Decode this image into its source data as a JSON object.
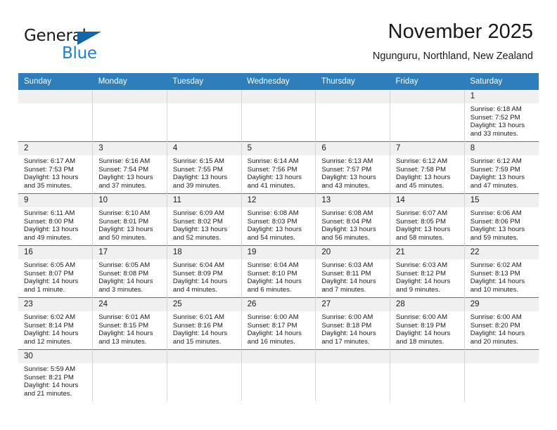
{
  "brand": {
    "name_top": "General",
    "name_bottom": "Blue",
    "flag_icon": "flag-triangle-icon",
    "color_dark": "#1a1a1a",
    "color_blue": "#1f7fd0"
  },
  "header": {
    "title": "November 2025",
    "subtitle": "Ngunguru, Northland, New Zealand"
  },
  "theme": {
    "header_bg": "#2e7ebc",
    "daynum_bg": "#f0f0f0",
    "row_border": "#2e7ebc",
    "cell_border": "#d4d4d4"
  },
  "weekday_headers": [
    "Sunday",
    "Monday",
    "Tuesday",
    "Wednesday",
    "Thursday",
    "Friday",
    "Saturday"
  ],
  "weeks": [
    [
      {
        "day": "",
        "empty": true,
        "sunrise": "",
        "sunset": "",
        "daylight1": "",
        "daylight2": ""
      },
      {
        "day": "",
        "empty": true,
        "sunrise": "",
        "sunset": "",
        "daylight1": "",
        "daylight2": ""
      },
      {
        "day": "",
        "empty": true,
        "sunrise": "",
        "sunset": "",
        "daylight1": "",
        "daylight2": ""
      },
      {
        "day": "",
        "empty": true,
        "sunrise": "",
        "sunset": "",
        "daylight1": "",
        "daylight2": ""
      },
      {
        "day": "",
        "empty": true,
        "sunrise": "",
        "sunset": "",
        "daylight1": "",
        "daylight2": ""
      },
      {
        "day": "",
        "empty": true,
        "sunrise": "",
        "sunset": "",
        "daylight1": "",
        "daylight2": ""
      },
      {
        "day": "1",
        "empty": false,
        "sunrise": "Sunrise: 6:18 AM",
        "sunset": "Sunset: 7:52 PM",
        "daylight1": "Daylight: 13 hours",
        "daylight2": "and 33 minutes."
      }
    ],
    [
      {
        "day": "2",
        "empty": false,
        "sunrise": "Sunrise: 6:17 AM",
        "sunset": "Sunset: 7:53 PM",
        "daylight1": "Daylight: 13 hours",
        "daylight2": "and 35 minutes."
      },
      {
        "day": "3",
        "empty": false,
        "sunrise": "Sunrise: 6:16 AM",
        "sunset": "Sunset: 7:54 PM",
        "daylight1": "Daylight: 13 hours",
        "daylight2": "and 37 minutes."
      },
      {
        "day": "4",
        "empty": false,
        "sunrise": "Sunrise: 6:15 AM",
        "sunset": "Sunset: 7:55 PM",
        "daylight1": "Daylight: 13 hours",
        "daylight2": "and 39 minutes."
      },
      {
        "day": "5",
        "empty": false,
        "sunrise": "Sunrise: 6:14 AM",
        "sunset": "Sunset: 7:56 PM",
        "daylight1": "Daylight: 13 hours",
        "daylight2": "and 41 minutes."
      },
      {
        "day": "6",
        "empty": false,
        "sunrise": "Sunrise: 6:13 AM",
        "sunset": "Sunset: 7:57 PM",
        "daylight1": "Daylight: 13 hours",
        "daylight2": "and 43 minutes."
      },
      {
        "day": "7",
        "empty": false,
        "sunrise": "Sunrise: 6:12 AM",
        "sunset": "Sunset: 7:58 PM",
        "daylight1": "Daylight: 13 hours",
        "daylight2": "and 45 minutes."
      },
      {
        "day": "8",
        "empty": false,
        "sunrise": "Sunrise: 6:12 AM",
        "sunset": "Sunset: 7:59 PM",
        "daylight1": "Daylight: 13 hours",
        "daylight2": "and 47 minutes."
      }
    ],
    [
      {
        "day": "9",
        "empty": false,
        "sunrise": "Sunrise: 6:11 AM",
        "sunset": "Sunset: 8:00 PM",
        "daylight1": "Daylight: 13 hours",
        "daylight2": "and 49 minutes."
      },
      {
        "day": "10",
        "empty": false,
        "sunrise": "Sunrise: 6:10 AM",
        "sunset": "Sunset: 8:01 PM",
        "daylight1": "Daylight: 13 hours",
        "daylight2": "and 50 minutes."
      },
      {
        "day": "11",
        "empty": false,
        "sunrise": "Sunrise: 6:09 AM",
        "sunset": "Sunset: 8:02 PM",
        "daylight1": "Daylight: 13 hours",
        "daylight2": "and 52 minutes."
      },
      {
        "day": "12",
        "empty": false,
        "sunrise": "Sunrise: 6:08 AM",
        "sunset": "Sunset: 8:03 PM",
        "daylight1": "Daylight: 13 hours",
        "daylight2": "and 54 minutes."
      },
      {
        "day": "13",
        "empty": false,
        "sunrise": "Sunrise: 6:08 AM",
        "sunset": "Sunset: 8:04 PM",
        "daylight1": "Daylight: 13 hours",
        "daylight2": "and 56 minutes."
      },
      {
        "day": "14",
        "empty": false,
        "sunrise": "Sunrise: 6:07 AM",
        "sunset": "Sunset: 8:05 PM",
        "daylight1": "Daylight: 13 hours",
        "daylight2": "and 58 minutes."
      },
      {
        "day": "15",
        "empty": false,
        "sunrise": "Sunrise: 6:06 AM",
        "sunset": "Sunset: 8:06 PM",
        "daylight1": "Daylight: 13 hours",
        "daylight2": "and 59 minutes."
      }
    ],
    [
      {
        "day": "16",
        "empty": false,
        "sunrise": "Sunrise: 6:05 AM",
        "sunset": "Sunset: 8:07 PM",
        "daylight1": "Daylight: 14 hours",
        "daylight2": "and 1 minute."
      },
      {
        "day": "17",
        "empty": false,
        "sunrise": "Sunrise: 6:05 AM",
        "sunset": "Sunset: 8:08 PM",
        "daylight1": "Daylight: 14 hours",
        "daylight2": "and 3 minutes."
      },
      {
        "day": "18",
        "empty": false,
        "sunrise": "Sunrise: 6:04 AM",
        "sunset": "Sunset: 8:09 PM",
        "daylight1": "Daylight: 14 hours",
        "daylight2": "and 4 minutes."
      },
      {
        "day": "19",
        "empty": false,
        "sunrise": "Sunrise: 6:04 AM",
        "sunset": "Sunset: 8:10 PM",
        "daylight1": "Daylight: 14 hours",
        "daylight2": "and 6 minutes."
      },
      {
        "day": "20",
        "empty": false,
        "sunrise": "Sunrise: 6:03 AM",
        "sunset": "Sunset: 8:11 PM",
        "daylight1": "Daylight: 14 hours",
        "daylight2": "and 7 minutes."
      },
      {
        "day": "21",
        "empty": false,
        "sunrise": "Sunrise: 6:03 AM",
        "sunset": "Sunset: 8:12 PM",
        "daylight1": "Daylight: 14 hours",
        "daylight2": "and 9 minutes."
      },
      {
        "day": "22",
        "empty": false,
        "sunrise": "Sunrise: 6:02 AM",
        "sunset": "Sunset: 8:13 PM",
        "daylight1": "Daylight: 14 hours",
        "daylight2": "and 10 minutes."
      }
    ],
    [
      {
        "day": "23",
        "empty": false,
        "sunrise": "Sunrise: 6:02 AM",
        "sunset": "Sunset: 8:14 PM",
        "daylight1": "Daylight: 14 hours",
        "daylight2": "and 12 minutes."
      },
      {
        "day": "24",
        "empty": false,
        "sunrise": "Sunrise: 6:01 AM",
        "sunset": "Sunset: 8:15 PM",
        "daylight1": "Daylight: 14 hours",
        "daylight2": "and 13 minutes."
      },
      {
        "day": "25",
        "empty": false,
        "sunrise": "Sunrise: 6:01 AM",
        "sunset": "Sunset: 8:16 PM",
        "daylight1": "Daylight: 14 hours",
        "daylight2": "and 15 minutes."
      },
      {
        "day": "26",
        "empty": false,
        "sunrise": "Sunrise: 6:00 AM",
        "sunset": "Sunset: 8:17 PM",
        "daylight1": "Daylight: 14 hours",
        "daylight2": "and 16 minutes."
      },
      {
        "day": "27",
        "empty": false,
        "sunrise": "Sunrise: 6:00 AM",
        "sunset": "Sunset: 8:18 PM",
        "daylight1": "Daylight: 14 hours",
        "daylight2": "and 17 minutes."
      },
      {
        "day": "28",
        "empty": false,
        "sunrise": "Sunrise: 6:00 AM",
        "sunset": "Sunset: 8:19 PM",
        "daylight1": "Daylight: 14 hours",
        "daylight2": "and 18 minutes."
      },
      {
        "day": "29",
        "empty": false,
        "sunrise": "Sunrise: 6:00 AM",
        "sunset": "Sunset: 8:20 PM",
        "daylight1": "Daylight: 14 hours",
        "daylight2": "and 20 minutes."
      }
    ],
    [
      {
        "day": "30",
        "empty": false,
        "sunrise": "Sunrise: 5:59 AM",
        "sunset": "Sunset: 8:21 PM",
        "daylight1": "Daylight: 14 hours",
        "daylight2": "and 21 minutes."
      },
      {
        "day": "",
        "empty": true,
        "sunrise": "",
        "sunset": "",
        "daylight1": "",
        "daylight2": ""
      },
      {
        "day": "",
        "empty": true,
        "sunrise": "",
        "sunset": "",
        "daylight1": "",
        "daylight2": ""
      },
      {
        "day": "",
        "empty": true,
        "sunrise": "",
        "sunset": "",
        "daylight1": "",
        "daylight2": ""
      },
      {
        "day": "",
        "empty": true,
        "sunrise": "",
        "sunset": "",
        "daylight1": "",
        "daylight2": ""
      },
      {
        "day": "",
        "empty": true,
        "sunrise": "",
        "sunset": "",
        "daylight1": "",
        "daylight2": ""
      },
      {
        "day": "",
        "empty": true,
        "sunrise": "",
        "sunset": "",
        "daylight1": "",
        "daylight2": ""
      }
    ]
  ]
}
